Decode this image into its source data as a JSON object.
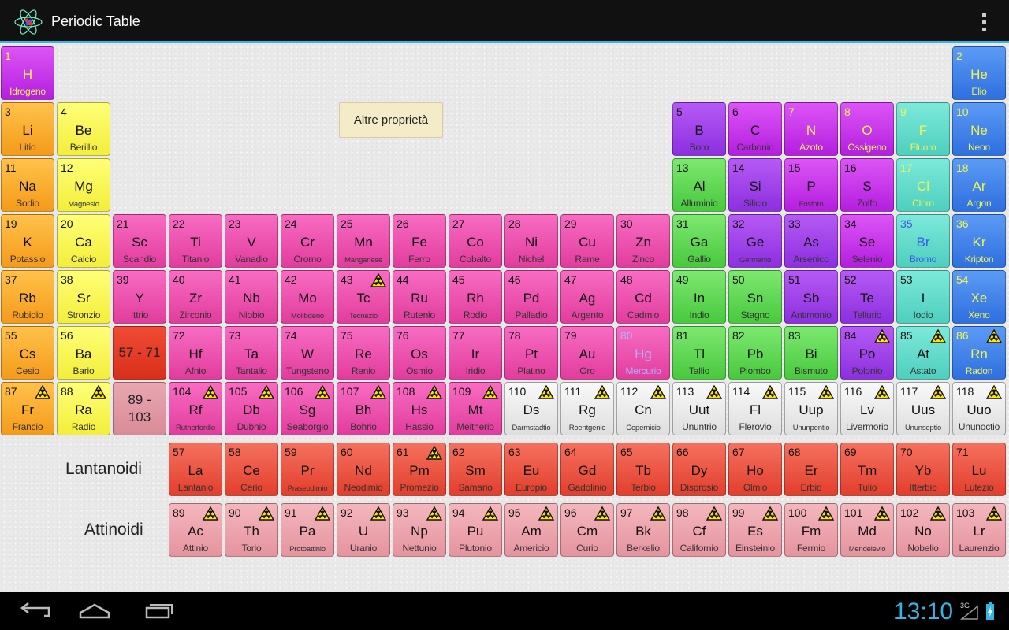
{
  "app": {
    "title": "Periodic Table",
    "icon": "atom-icon",
    "accent": "#33b5e5"
  },
  "menu": {
    "icon": "overflow-menu-icon"
  },
  "buttons": {
    "more_properties": "Altre proprietà"
  },
  "series": {
    "lanthanides_label": "Lantanoidi",
    "actinides_label": "Attinoidi",
    "lanthanides_range": "57 - 71",
    "actinides_range": "89 - 103"
  },
  "elements": [
    {
      "n": "1",
      "s": "H",
      "name": "Idrogeno",
      "cat": "nonmetal",
      "row": 1,
      "col": 1,
      "hl": true
    },
    {
      "n": "2",
      "s": "He",
      "name": "Elio",
      "cat": "noble",
      "row": 1,
      "col": 18,
      "hl": true
    },
    {
      "n": "3",
      "s": "Li",
      "name": "Litio",
      "cat": "alkali",
      "row": 2,
      "col": 1
    },
    {
      "n": "4",
      "s": "Be",
      "name": "Berillio",
      "cat": "alkearth",
      "row": 2,
      "col": 2
    },
    {
      "n": "5",
      "s": "B",
      "name": "Boro",
      "cat": "metalloid",
      "row": 2,
      "col": 13
    },
    {
      "n": "6",
      "s": "C",
      "name": "Carbonio",
      "cat": "nonmetal",
      "row": 2,
      "col": 14
    },
    {
      "n": "7",
      "s": "N",
      "name": "Azoto",
      "cat": "nonmetal",
      "row": 2,
      "col": 15,
      "hl": true
    },
    {
      "n": "8",
      "s": "O",
      "name": "Ossigeno",
      "cat": "nonmetal",
      "row": 2,
      "col": 16,
      "hl": true
    },
    {
      "n": "9",
      "s": "F",
      "name": "Fluoro",
      "cat": "halogen",
      "row": 2,
      "col": 17,
      "hl": true
    },
    {
      "n": "10",
      "s": "Ne",
      "name": "Neon",
      "cat": "noble",
      "row": 2,
      "col": 18,
      "hl": true
    },
    {
      "n": "11",
      "s": "Na",
      "name": "Sodio",
      "cat": "alkali",
      "row": 3,
      "col": 1
    },
    {
      "n": "12",
      "s": "Mg",
      "name": "Magnesio",
      "cat": "alkearth",
      "row": 3,
      "col": 2,
      "small": true
    },
    {
      "n": "13",
      "s": "Al",
      "name": "Alluminio",
      "cat": "posttrans",
      "row": 3,
      "col": 13
    },
    {
      "n": "14",
      "s": "Si",
      "name": "Silicio",
      "cat": "metalloid",
      "row": 3,
      "col": 14
    },
    {
      "n": "15",
      "s": "P",
      "name": "Fosforo",
      "cat": "nonmetal",
      "row": 3,
      "col": 15,
      "small": true
    },
    {
      "n": "16",
      "s": "S",
      "name": "Zolfo",
      "cat": "nonmetal",
      "row": 3,
      "col": 16
    },
    {
      "n": "17",
      "s": "Cl",
      "name": "Cloro",
      "cat": "halogen",
      "row": 3,
      "col": 17,
      "hl": true
    },
    {
      "n": "18",
      "s": "Ar",
      "name": "Argon",
      "cat": "noble",
      "row": 3,
      "col": 18,
      "hl": true
    },
    {
      "n": "19",
      "s": "K",
      "name": "Potassio",
      "cat": "alkali",
      "row": 4,
      "col": 1
    },
    {
      "n": "20",
      "s": "Ca",
      "name": "Calcio",
      "cat": "alkearth",
      "row": 4,
      "col": 2
    },
    {
      "n": "21",
      "s": "Sc",
      "name": "Scandio",
      "cat": "transition",
      "row": 4,
      "col": 3
    },
    {
      "n": "22",
      "s": "Ti",
      "name": "Titanio",
      "cat": "transition",
      "row": 4,
      "col": 4
    },
    {
      "n": "23",
      "s": "V",
      "name": "Vanadio",
      "cat": "transition",
      "row": 4,
      "col": 5
    },
    {
      "n": "24",
      "s": "Cr",
      "name": "Cromo",
      "cat": "transition",
      "row": 4,
      "col": 6
    },
    {
      "n": "25",
      "s": "Mn",
      "name": "Manganese",
      "cat": "transition",
      "row": 4,
      "col": 7,
      "small": true
    },
    {
      "n": "26",
      "s": "Fe",
      "name": "Ferro",
      "cat": "transition",
      "row": 4,
      "col": 8
    },
    {
      "n": "27",
      "s": "Co",
      "name": "Cobalto",
      "cat": "transition",
      "row": 4,
      "col": 9
    },
    {
      "n": "28",
      "s": "Ni",
      "name": "Nichel",
      "cat": "transition",
      "row": 4,
      "col": 10
    },
    {
      "n": "29",
      "s": "Cu",
      "name": "Rame",
      "cat": "transition",
      "row": 4,
      "col": 11
    },
    {
      "n": "30",
      "s": "Zn",
      "name": "Zinco",
      "cat": "transition",
      "row": 4,
      "col": 12
    },
    {
      "n": "31",
      "s": "Ga",
      "name": "Gallio",
      "cat": "posttrans",
      "row": 4,
      "col": 13
    },
    {
      "n": "32",
      "s": "Ge",
      "name": "Germanio",
      "cat": "metalloid",
      "row": 4,
      "col": 14,
      "small": true
    },
    {
      "n": "33",
      "s": "As",
      "name": "Arsenico",
      "cat": "metalloid",
      "row": 4,
      "col": 15
    },
    {
      "n": "34",
      "s": "Se",
      "name": "Selenio",
      "cat": "nonmetal",
      "row": 4,
      "col": 16
    },
    {
      "n": "35",
      "s": "Br",
      "name": "Bromo",
      "cat": "halogen",
      "row": 4,
      "col": 17,
      "liq": true
    },
    {
      "n": "36",
      "s": "Kr",
      "name": "Kripton",
      "cat": "noble",
      "row": 4,
      "col": 18,
      "hl": true
    },
    {
      "n": "37",
      "s": "Rb",
      "name": "Rubidio",
      "cat": "alkali",
      "row": 5,
      "col": 1
    },
    {
      "n": "38",
      "s": "Sr",
      "name": "Stronzio",
      "cat": "alkearth",
      "row": 5,
      "col": 2
    },
    {
      "n": "39",
      "s": "Y",
      "name": "Ittrio",
      "cat": "transition",
      "row": 5,
      "col": 3
    },
    {
      "n": "40",
      "s": "Zr",
      "name": "Zirconio",
      "cat": "transition",
      "row": 5,
      "col": 4
    },
    {
      "n": "41",
      "s": "Nb",
      "name": "Niobio",
      "cat": "transition",
      "row": 5,
      "col": 5
    },
    {
      "n": "42",
      "s": "Mo",
      "name": "Molibdeno",
      "cat": "transition",
      "row": 5,
      "col": 6,
      "small": true
    },
    {
      "n": "43",
      "s": "Tc",
      "name": "Tecnezio",
      "cat": "transition",
      "row": 5,
      "col": 7,
      "rad": true,
      "small": true
    },
    {
      "n": "44",
      "s": "Ru",
      "name": "Rutenio",
      "cat": "transition",
      "row": 5,
      "col": 8
    },
    {
      "n": "45",
      "s": "Rh",
      "name": "Rodio",
      "cat": "transition",
      "row": 5,
      "col": 9
    },
    {
      "n": "46",
      "s": "Pd",
      "name": "Palladio",
      "cat": "transition",
      "row": 5,
      "col": 10
    },
    {
      "n": "47",
      "s": "Ag",
      "name": "Argento",
      "cat": "transition",
      "row": 5,
      "col": 11
    },
    {
      "n": "48",
      "s": "Cd",
      "name": "Cadmio",
      "cat": "transition",
      "row": 5,
      "col": 12
    },
    {
      "n": "49",
      "s": "In",
      "name": "Indio",
      "cat": "posttrans",
      "row": 5,
      "col": 13
    },
    {
      "n": "50",
      "s": "Sn",
      "name": "Stagno",
      "cat": "posttrans",
      "row": 5,
      "col": 14
    },
    {
      "n": "51",
      "s": "Sb",
      "name": "Antimonio",
      "cat": "metalloid",
      "row": 5,
      "col": 15
    },
    {
      "n": "52",
      "s": "Te",
      "name": "Tellurio",
      "cat": "metalloid",
      "row": 5,
      "col": 16
    },
    {
      "n": "53",
      "s": "I",
      "name": "Iodio",
      "cat": "halogen",
      "row": 5,
      "col": 17
    },
    {
      "n": "54",
      "s": "Xe",
      "name": "Xeno",
      "cat": "noble",
      "row": 5,
      "col": 18,
      "hl": true
    },
    {
      "n": "55",
      "s": "Cs",
      "name": "Cesio",
      "cat": "alkali",
      "row": 6,
      "col": 1
    },
    {
      "n": "56",
      "s": "Ba",
      "name": "Bario",
      "cat": "alkearth",
      "row": 6,
      "col": 2
    },
    {
      "n": "72",
      "s": "Hf",
      "name": "Afnio",
      "cat": "transition",
      "row": 6,
      "col": 4
    },
    {
      "n": "73",
      "s": "Ta",
      "name": "Tantalio",
      "cat": "transition",
      "row": 6,
      "col": 5
    },
    {
      "n": "74",
      "s": "W",
      "name": "Tungsteno",
      "cat": "transition",
      "row": 6,
      "col": 6
    },
    {
      "n": "75",
      "s": "Re",
      "name": "Renio",
      "cat": "transition",
      "row": 6,
      "col": 7
    },
    {
      "n": "76",
      "s": "Os",
      "name": "Osmio",
      "cat": "transition",
      "row": 6,
      "col": 8
    },
    {
      "n": "77",
      "s": "Ir",
      "name": "Iridio",
      "cat": "transition",
      "row": 6,
      "col": 9
    },
    {
      "n": "78",
      "s": "Pt",
      "name": "Platino",
      "cat": "transition",
      "row": 6,
      "col": 10
    },
    {
      "n": "79",
      "s": "Au",
      "name": "Oro",
      "cat": "transition",
      "row": 6,
      "col": 11
    },
    {
      "n": "80",
      "s": "Hg",
      "name": "Mercurio",
      "cat": "transition",
      "row": 6,
      "col": 12,
      "liq2": true
    },
    {
      "n": "81",
      "s": "Tl",
      "name": "Tallio",
      "cat": "posttrans",
      "row": 6,
      "col": 13
    },
    {
      "n": "82",
      "s": "Pb",
      "name": "Piombo",
      "cat": "posttrans",
      "row": 6,
      "col": 14
    },
    {
      "n": "83",
      "s": "Bi",
      "name": "Bismuto",
      "cat": "posttrans",
      "row": 6,
      "col": 15
    },
    {
      "n": "84",
      "s": "Po",
      "name": "Polonio",
      "cat": "metalloid",
      "row": 6,
      "col": 16,
      "rad": true
    },
    {
      "n": "85",
      "s": "At",
      "name": "Astato",
      "cat": "halogen",
      "row": 6,
      "col": 17,
      "rad": true
    },
    {
      "n": "86",
      "s": "Rn",
      "name": "Radon",
      "cat": "noble",
      "row": 6,
      "col": 18,
      "rad": true,
      "hl": true
    },
    {
      "n": "87",
      "s": "Fr",
      "name": "Francio",
      "cat": "alkali",
      "row": 7,
      "col": 1,
      "rad": true
    },
    {
      "n": "88",
      "s": "Ra",
      "name": "Radio",
      "cat": "alkearth",
      "row": 7,
      "col": 2,
      "rad": true
    },
    {
      "n": "104",
      "s": "Rf",
      "name": "Rutherfordio",
      "cat": "transition",
      "row": 7,
      "col": 4,
      "rad": true,
      "small": true
    },
    {
      "n": "105",
      "s": "Db",
      "name": "Dubnio",
      "cat": "transition",
      "row": 7,
      "col": 5,
      "rad": true
    },
    {
      "n": "106",
      "s": "Sg",
      "name": "Seaborgio",
      "cat": "transition",
      "row": 7,
      "col": 6,
      "rad": true
    },
    {
      "n": "107",
      "s": "Bh",
      "name": "Bohrio",
      "cat": "transition",
      "row": 7,
      "col": 7,
      "rad": true
    },
    {
      "n": "108",
      "s": "Hs",
      "name": "Hassio",
      "cat": "transition",
      "row": 7,
      "col": 8,
      "rad": true
    },
    {
      "n": "109",
      "s": "Mt",
      "name": "Meitnerio",
      "cat": "transition",
      "row": 7,
      "col": 9,
      "rad": true
    },
    {
      "n": "110",
      "s": "Ds",
      "name": "Darmstadtio",
      "cat": "unknown",
      "row": 7,
      "col": 10,
      "rad": true,
      "small": true
    },
    {
      "n": "111",
      "s": "Rg",
      "name": "Roentgenio",
      "cat": "unknown",
      "row": 7,
      "col": 11,
      "rad": true,
      "small": true
    },
    {
      "n": "112",
      "s": "Cn",
      "name": "Copernicio",
      "cat": "unknown",
      "row": 7,
      "col": 12,
      "rad": true,
      "small": true
    },
    {
      "n": "113",
      "s": "Uut",
      "name": "Ununtrio",
      "cat": "unknown",
      "row": 7,
      "col": 13,
      "rad": true
    },
    {
      "n": "114",
      "s": "Fl",
      "name": "Flerovio",
      "cat": "unknown",
      "row": 7,
      "col": 14,
      "rad": true
    },
    {
      "n": "115",
      "s": "Uup",
      "name": "Ununpentio",
      "cat": "unknown",
      "row": 7,
      "col": 15,
      "rad": true,
      "small": true
    },
    {
      "n": "116",
      "s": "Lv",
      "name": "Livermorio",
      "cat": "unknown",
      "row": 7,
      "col": 16,
      "rad": true
    },
    {
      "n": "117",
      "s": "Uus",
      "name": "Ununseptio",
      "cat": "unknown",
      "row": 7,
      "col": 17,
      "rad": true,
      "small": true
    },
    {
      "n": "118",
      "s": "Uuo",
      "name": "Ununoctio",
      "cat": "unknown",
      "row": 7,
      "col": 18,
      "rad": true
    },
    {
      "n": "57",
      "s": "La",
      "name": "Lantanio",
      "cat": "lanthanide",
      "row": 8,
      "col": 4
    },
    {
      "n": "58",
      "s": "Ce",
      "name": "Cerio",
      "cat": "lanthanide",
      "row": 8,
      "col": 5
    },
    {
      "n": "59",
      "s": "Pr",
      "name": "Praseodimio",
      "cat": "lanthanide",
      "row": 8,
      "col": 6,
      "small": true
    },
    {
      "n": "60",
      "s": "Nd",
      "name": "Neodimio",
      "cat": "lanthanide",
      "row": 8,
      "col": 7
    },
    {
      "n": "61",
      "s": "Pm",
      "name": "Promezio",
      "cat": "lanthanide",
      "row": 8,
      "col": 8,
      "rad": true
    },
    {
      "n": "62",
      "s": "Sm",
      "name": "Samario",
      "cat": "lanthanide",
      "row": 8,
      "col": 9
    },
    {
      "n": "63",
      "s": "Eu",
      "name": "Europio",
      "cat": "lanthanide",
      "row": 8,
      "col": 10
    },
    {
      "n": "64",
      "s": "Gd",
      "name": "Gadolinio",
      "cat": "lanthanide",
      "row": 8,
      "col": 11
    },
    {
      "n": "65",
      "s": "Tb",
      "name": "Terbio",
      "cat": "lanthanide",
      "row": 8,
      "col": 12
    },
    {
      "n": "66",
      "s": "Dy",
      "name": "Disprosio",
      "cat": "lanthanide",
      "row": 8,
      "col": 13
    },
    {
      "n": "67",
      "s": "Ho",
      "name": "Olmio",
      "cat": "lanthanide",
      "row": 8,
      "col": 14
    },
    {
      "n": "68",
      "s": "Er",
      "name": "Erbio",
      "cat": "lanthanide",
      "row": 8,
      "col": 15
    },
    {
      "n": "69",
      "s": "Tm",
      "name": "Tulio",
      "cat": "lanthanide",
      "row": 8,
      "col": 16
    },
    {
      "n": "70",
      "s": "Yb",
      "name": "Itterbio",
      "cat": "lanthanide",
      "row": 8,
      "col": 17
    },
    {
      "n": "71",
      "s": "Lu",
      "name": "Lutezio",
      "cat": "lanthanide",
      "row": 8,
      "col": 18
    },
    {
      "n": "89",
      "s": "Ac",
      "name": "Attinio",
      "cat": "actinide",
      "row": 9,
      "col": 4,
      "rad": true
    },
    {
      "n": "90",
      "s": "Th",
      "name": "Torio",
      "cat": "actinide",
      "row": 9,
      "col": 5,
      "rad": true
    },
    {
      "n": "91",
      "s": "Pa",
      "name": "Protoattinio",
      "cat": "actinide",
      "row": 9,
      "col": 6,
      "rad": true,
      "small": true
    },
    {
      "n": "92",
      "s": "U",
      "name": "Uranio",
      "cat": "actinide",
      "row": 9,
      "col": 7,
      "rad": true
    },
    {
      "n": "93",
      "s": "Np",
      "name": "Nettunio",
      "cat": "actinide",
      "row": 9,
      "col": 8,
      "rad": true
    },
    {
      "n": "94",
      "s": "Pu",
      "name": "Plutonio",
      "cat": "actinide",
      "row": 9,
      "col": 9,
      "rad": true
    },
    {
      "n": "95",
      "s": "Am",
      "name": "Americio",
      "cat": "actinide",
      "row": 9,
      "col": 10,
      "rad": true
    },
    {
      "n": "96",
      "s": "Cm",
      "name": "Curio",
      "cat": "actinide",
      "row": 9,
      "col": 11,
      "rad": true
    },
    {
      "n": "97",
      "s": "Bk",
      "name": "Berkelio",
      "cat": "actinide",
      "row": 9,
      "col": 12,
      "rad": true
    },
    {
      "n": "98",
      "s": "Cf",
      "name": "Californio",
      "cat": "actinide",
      "row": 9,
      "col": 13,
      "rad": true
    },
    {
      "n": "99",
      "s": "Es",
      "name": "Einsteinio",
      "cat": "actinide",
      "row": 9,
      "col": 14,
      "rad": true
    },
    {
      "n": "100",
      "s": "Fm",
      "name": "Fermio",
      "cat": "actinide",
      "row": 9,
      "col": 15,
      "rad": true
    },
    {
      "n": "101",
      "s": "Md",
      "name": "Mendelevio",
      "cat": "actinide",
      "row": 9,
      "col": 16,
      "rad": true,
      "small": true
    },
    {
      "n": "102",
      "s": "No",
      "name": "Nobelio",
      "cat": "actinide",
      "row": 9,
      "col": 17,
      "rad": true
    },
    {
      "n": "103",
      "s": "Lr",
      "name": "Laurenzio",
      "cat": "actinide",
      "row": 9,
      "col": 18,
      "rad": true
    }
  ],
  "statusbar": {
    "time": "13:10",
    "network": "3G"
  },
  "navbar": {
    "back_icon": "back-icon",
    "home_icon": "home-icon",
    "recents_icon": "recent-apps-icon"
  }
}
